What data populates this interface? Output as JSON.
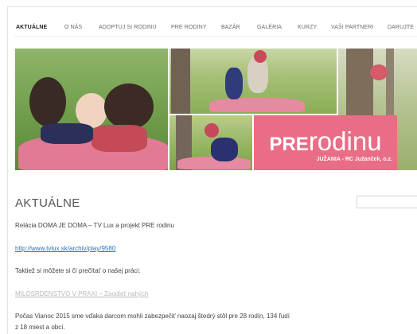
{
  "nav": {
    "items": [
      {
        "label": "AKTUÁLNE",
        "active": true
      },
      {
        "label": "O NÁS",
        "active": false
      },
      {
        "label": "ADOPTUJ SI RODINU",
        "active": false
      },
      {
        "label": "PRE RODINY",
        "active": false
      },
      {
        "label": "BAZÁR",
        "active": false
      },
      {
        "label": "GALÉRIA",
        "active": false
      },
      {
        "label": "KURZY",
        "active": false
      },
      {
        "label": "VAŠI PARTNERI",
        "active": false
      },
      {
        "label": "DARUJTE",
        "active": false
      }
    ]
  },
  "banner": {
    "logo_pre": "PRE",
    "logo_rodinu": "rodinu",
    "subtitle": "JUŽANIA - RC Južanček, o.z.",
    "brand_color": "#e96d86"
  },
  "content": {
    "title": "AKTUÁLNE",
    "p1": "Relácia DOMA JE DOMA – TV Lux a projekt PRE rodinu",
    "link1": "http://www.tvlux.sk/archiv/play/9580",
    "p2": "Taktiež si môžete si čí prečítať o našej práci:",
    "link2": "MILOSRDENSTVO V PRAXI – Zaodieť nahých",
    "p3_line1": "Počas Vianoc 2015 sme vďaka darcom mohli zabezpečiť naozaj štedrý stôl pre 28 rodín, 134 ľudí",
    "p3_line2": "z 18 miest a obcí."
  }
}
